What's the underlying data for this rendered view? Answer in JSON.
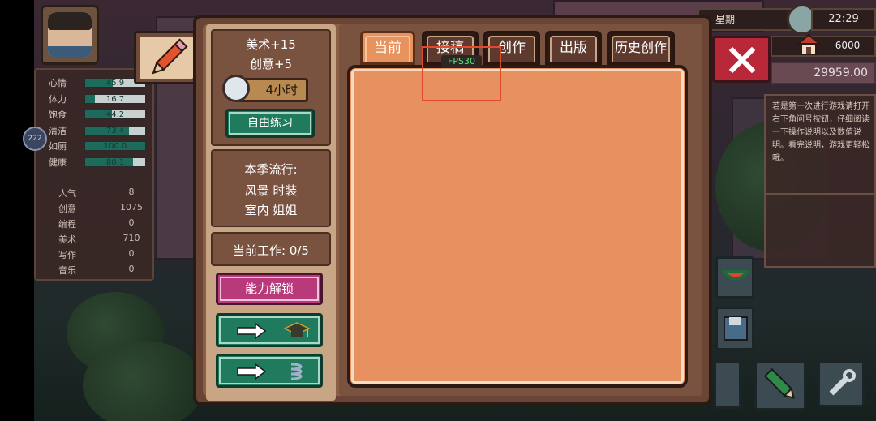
{
  "hud": {
    "day": "星期一",
    "time": "22:29",
    "money": "6000",
    "cash": "29959.00"
  },
  "stats": {
    "bars": [
      {
        "label": "心情",
        "value": "45.9",
        "fraction": 0.459
      },
      {
        "label": "体力",
        "value": "16.7",
        "fraction": 0.167
      },
      {
        "label": "饱食",
        "value": "44.2",
        "fraction": 0.442
      },
      {
        "label": "清洁",
        "value": "73.4",
        "fraction": 0.734
      },
      {
        "label": "如厕",
        "value": "100.0",
        "fraction": 1.0
      },
      {
        "label": "健康",
        "value": "80.1",
        "fraction": 0.801
      }
    ],
    "attributes": [
      {
        "label": "人气",
        "value": "8"
      },
      {
        "label": "创意",
        "value": "1075"
      },
      {
        "label": "编程",
        "value": "0"
      },
      {
        "label": "美术",
        "value": "710"
      },
      {
        "label": "写作",
        "value": "0"
      },
      {
        "label": "音乐",
        "value": "0"
      }
    ],
    "side_badge": "222"
  },
  "practice": {
    "gain_art": "美术+15",
    "gain_creativity": "创意+5",
    "duration": "4小时",
    "button": "自由练习"
  },
  "season": {
    "title": "本季流行:",
    "line1": "风景 时装",
    "line2": "室内 姐姐"
  },
  "work": {
    "label": "当前工作: 0/5"
  },
  "unlock_button": "能力解锁",
  "tabs": [
    {
      "label": "当前",
      "active": true
    },
    {
      "label": "接稿",
      "active": false
    },
    {
      "label": "创作",
      "active": false
    },
    {
      "label": "出版",
      "active": false
    },
    {
      "label": "历史创作",
      "active": false
    }
  ],
  "fps": "FPS30",
  "help_text": "若是第一次进行游戏请打开右下角问号按钮，仔细阅读一下操作说明以及数值说明。看完说明，游戏更轻松哦。",
  "colors": {
    "active_tab": "#e8935e",
    "green_button": "#1f7a5e",
    "pink_button": "#b83a7a",
    "close_button": "#b82838"
  }
}
